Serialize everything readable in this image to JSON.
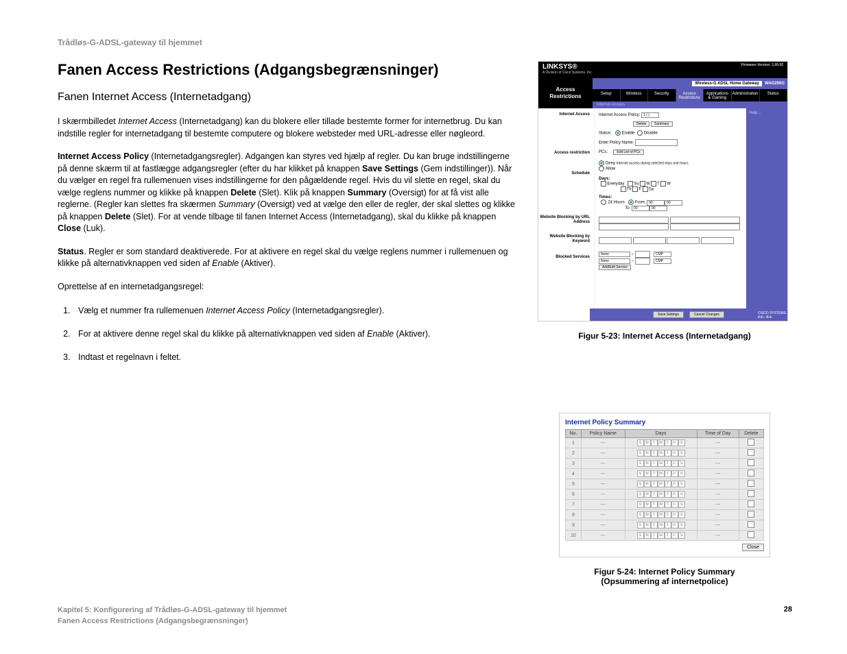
{
  "header": "Trådløs-G-ADSL-gateway til hjemmet",
  "h1": "Fanen Access Restrictions (Adgangsbegrænsninger)",
  "h2": "Fanen Internet Access (Internetadgang)",
  "p1a": "I skærmbilledet ",
  "p1b": "Internet Access",
  "p1c": " (Internetadgang) kan du blokere eller tillade bestemte former for internetbrug. Du kan indstille regler for internetadgang til bestemte computere og blokere websteder med URL-adresse eller nøgleord.",
  "p2a": "Internet Access Policy",
  "p2b": " (Internetadgangsregler). Adgangen kan styres ved hjælp af regler. Du kan bruge indstillingerne på denne skærm til at fastlægge adgangsregler (efter du har klikket på knappen ",
  "p2c": "Save Settings",
  "p2d": " (Gem indstillinger)). Når du vælger en regel fra rullemenuen vises indstillingerne for den pågældende regel. Hvis du vil slette en regel, skal du vælge reglens nummer og klikke på knappen ",
  "p2e": "Delete",
  "p2f": " (Slet). Klik på knappen ",
  "p2g": "Summary",
  "p2h": " (Oversigt) for at få vist alle reglerne. (Regler kan slettes fra skærmen ",
  "p2i": "Summary",
  "p2j": " (Oversigt) ved at vælge den eller de regler, der skal slettes og klikke på knappen ",
  "p2k": "Delete",
  "p2l": " (Slet). For at vende tilbage til fanen Internet Access (Internetadgang), skal du klikke på knappen ",
  "p2m": "Close",
  "p2n": " (Luk).",
  "p3a": "Status",
  "p3b": ". Regler er som standard deaktiverede. For at aktivere en regel skal du vælge reglens nummer i rullemenuen og klikke på alternativknappen ved siden af ",
  "p3c": "Enable",
  "p3d": " (Aktiver).",
  "p4": "Oprettelse af en internetadgangsregel:",
  "li1a": "Vælg et nummer fra rullemenuen ",
  "li1b": "Internet Access Policy",
  "li1c": " (Internetadgangsregler).",
  "li2a": "For at aktivere denne regel skal du klikke på alternativknappen ved siden af ",
  "li2b": "Enable",
  "li2c": " (Aktiver).",
  "li3": "Indtast et regelnavn i feltet.",
  "fig1": "Figur 5-23: Internet Access (Internetadgang)",
  "fig2a": "Figur 5-24: Internet Policy Summary",
  "fig2b": "(Opsummering af internetpolice)",
  "footer1": "Kapitel 5: Konfigurering af Trådløs-G-ADSL-gateway til hjemmet",
  "footer2": "Fanen Access Restrictions (Adgangsbegrænsninger)",
  "pagenum": "28",
  "linksys": {
    "brand": "LINKSYS®",
    "brandsub": "A Division of Cisco Systems, Inc.",
    "fw": "Firmware Version: 1.00.02",
    "modelLabel": "Wireless-G ADSL Home Gateway",
    "modelCode": "WAG200G",
    "section": "Access Restrictions",
    "tabs": [
      "Setup",
      "Wireless",
      "Security",
      "Access Restrictions",
      "Applications & Gaming",
      "Administration",
      "Status"
    ],
    "subtab": "Internet Access",
    "side": {
      "s1": "Internet Access",
      "s2": "Access restriction",
      "s3": "Schedule",
      "s4": "Website Blocking by URL Address",
      "s5": "Website Blocking by Keyword",
      "s6": "Blocked Services"
    },
    "help": "Help...",
    "form": {
      "policy": "Internet Access Policy:",
      "policyVal": "1 ( )",
      "delete": "Delete",
      "summary": "Summary",
      "status": "Status:",
      "enable": "Enable",
      "disable": "Disable",
      "epn": "Enter Policy Name:",
      "pcs": "PCs:",
      "editlist": "Edit List of PCs",
      "deny": "Deny",
      "allow": "Allow",
      "denytxt": "Internet access during selected days and hours.",
      "days": "Days:",
      "everyday": "Everyday",
      "dSu": "Su",
      "dM": "M",
      "dT": "T",
      "dW": "W",
      "dTh": "Th",
      "dF": "F",
      "dSa": "Sa",
      "times": "Times:",
      "h24": "24 Hours",
      "from": "From:",
      "to": "To:",
      "none": "None",
      "addedit": "Add/Edit Service",
      "save": "Save Settings",
      "cancel": "Cancel Changes"
    }
  },
  "summary": {
    "title": "Internet Policy Summary",
    "cols": [
      "No.",
      "Policy Name",
      "Days",
      "Time of Day",
      "Delete"
    ],
    "dayLetters": [
      "S",
      "M",
      "T",
      "W",
      "T",
      "F",
      "S"
    ],
    "dash": "---",
    "rows": [
      "1",
      "2",
      "3",
      "4",
      "5",
      "6",
      "7",
      "8",
      "9",
      "10"
    ],
    "close": "Close"
  }
}
